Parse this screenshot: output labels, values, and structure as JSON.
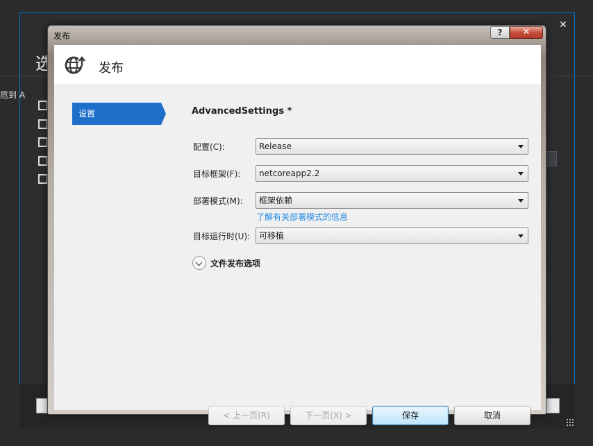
{
  "background": {
    "title_fragment": "选",
    "side_text_fragment": "卮到 A"
  },
  "dialog": {
    "title": "发布",
    "help_label": "?",
    "close_label": "✕",
    "header_title": "发布"
  },
  "nav": {
    "items": [
      {
        "label": "设置",
        "selected": true
      }
    ]
  },
  "content": {
    "section_title": "AdvancedSettings *",
    "fields": [
      {
        "label": "配置(C):",
        "value": "Release"
      },
      {
        "label": "目标框架(F):",
        "value": "netcoreapp2.2"
      },
      {
        "label": "部署模式(M):",
        "value": "框架依赖"
      },
      {
        "label": "目标运行时(U):",
        "value": "可移植"
      }
    ],
    "deployment_mode_link": "了解有关部署模式的信息",
    "expander_label": "文件发布选项"
  },
  "buttons": {
    "prev": "< 上一页(R)",
    "next": "下一页(X) >",
    "save": "保存",
    "cancel": "取消"
  },
  "colors": {
    "accent": "#1e6fc9",
    "link": "#1e88e5",
    "bg_window_border": "#007acc"
  }
}
